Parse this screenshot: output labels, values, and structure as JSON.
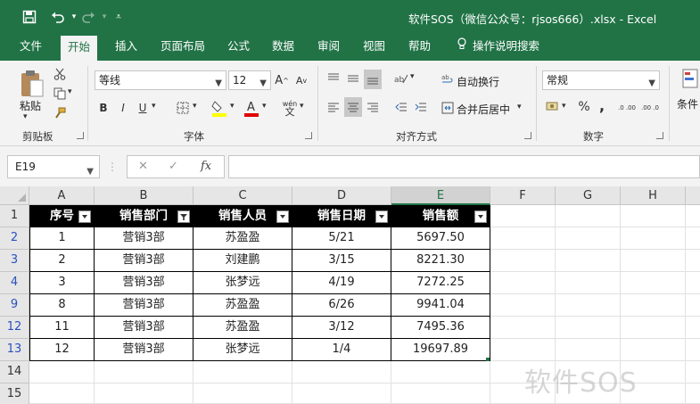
{
  "window": {
    "title": "软件SOS（微信公众号：rjsos666）.xlsx - Excel"
  },
  "ribbon_tabs": [
    "文件",
    "开始",
    "插入",
    "页面布局",
    "公式",
    "数据",
    "审阅",
    "视图",
    "帮助",
    "操作说明搜索"
  ],
  "active_tab": "开始",
  "ribbon": {
    "clipboard": {
      "paste_label": "粘贴",
      "group_label": "剪贴板"
    },
    "font": {
      "font_name": "等线",
      "font_size": "12",
      "grow": "A",
      "shrink": "A",
      "bold": "B",
      "italic": "I",
      "underline": "U",
      "phonetic": "wén",
      "group_label": "字体"
    },
    "alignment": {
      "wrap_text": "自动换行",
      "merge_center": "合并后居中",
      "group_label": "对齐方式"
    },
    "number": {
      "format": "常规",
      "percent": "%",
      "comma": ",",
      "inc_decimal": ".0 .00",
      "dec_decimal": ".00 .0",
      "group_label": "数字"
    },
    "styles": {
      "conditional": "条件"
    }
  },
  "formula_bar": {
    "name_box": "E19",
    "fx": "fx",
    "formula": ""
  },
  "sheet": {
    "column_headers": [
      "A",
      "B",
      "C",
      "D",
      "E",
      "F",
      "G",
      "H"
    ],
    "selected_column": "E",
    "row_numbers": [
      "1",
      "2",
      "3",
      "4",
      "9",
      "12",
      "13",
      "14",
      "15"
    ],
    "table_headers": [
      "序号",
      "销售部门",
      "销售人员",
      "销售日期",
      "销售额"
    ],
    "filtered_column": "销售部门",
    "rows": [
      [
        "1",
        "营销3部",
        "苏盈盈",
        "5/21",
        "5697.50"
      ],
      [
        "2",
        "营销3部",
        "刘建鹏",
        "3/15",
        "8221.30"
      ],
      [
        "3",
        "营销3部",
        "张梦远",
        "4/19",
        "7272.25"
      ],
      [
        "8",
        "营销3部",
        "苏盈盈",
        "6/26",
        "9941.04"
      ],
      [
        "11",
        "营销3部",
        "苏盈盈",
        "3/12",
        "7495.36"
      ],
      [
        "12",
        "营销3部",
        "张梦远",
        "1/4",
        "19697.89"
      ]
    ]
  },
  "watermark": "软件SOS",
  "colors": {
    "excel_green": "#217346",
    "header_fill": "#000000",
    "filtered_row_number": "#2a52be"
  }
}
